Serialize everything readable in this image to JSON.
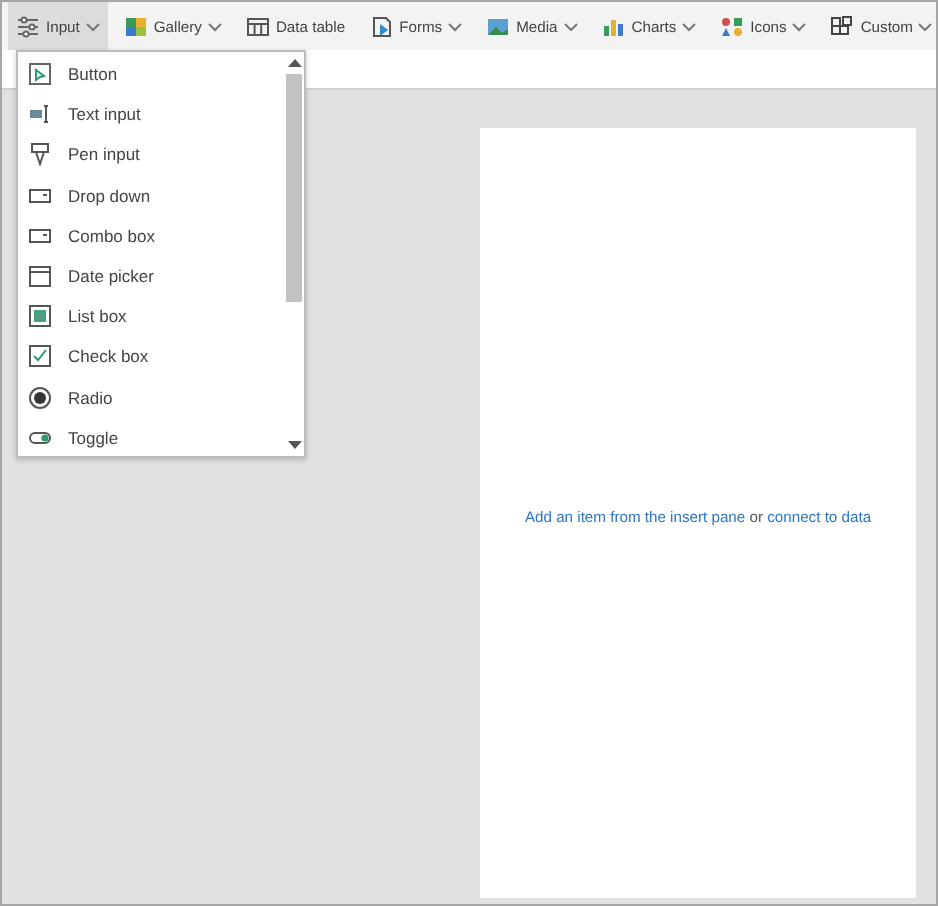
{
  "toolbar": [
    {
      "label": "Input",
      "has_menu": true,
      "selected": true
    },
    {
      "label": "Gallery",
      "has_menu": true,
      "selected": false
    },
    {
      "label": "Data table",
      "has_menu": false,
      "selected": false
    },
    {
      "label": "Forms",
      "has_menu": true,
      "selected": false
    },
    {
      "label": "Media",
      "has_menu": true,
      "selected": false
    },
    {
      "label": "Charts",
      "has_menu": true,
      "selected": false
    },
    {
      "label": "Icons",
      "has_menu": true,
      "selected": false
    },
    {
      "label": "Custom",
      "has_menu": true,
      "selected": false
    }
  ],
  "menu": {
    "items": [
      {
        "label": "Button"
      },
      {
        "label": "Text input"
      },
      {
        "label": "Pen input"
      },
      {
        "label": "Drop down"
      },
      {
        "label": "Combo box"
      },
      {
        "label": "Date picker"
      },
      {
        "label": "List box"
      },
      {
        "label": "Check box"
      },
      {
        "label": "Radio"
      },
      {
        "label": "Toggle"
      }
    ]
  },
  "canvas": {
    "message": {
      "link_insert": "Add an item from the insert pane",
      "or": "or",
      "link_connect": "connect to data"
    }
  }
}
